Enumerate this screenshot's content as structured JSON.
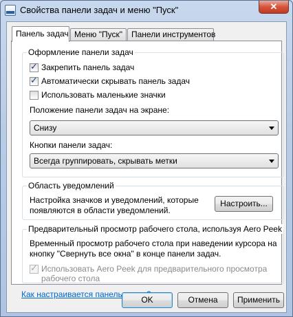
{
  "window": {
    "title": "Свойства панели задач и меню \"Пуск\"",
    "close_label": "✕"
  },
  "tabs": [
    {
      "label": "Панель задач",
      "active": true
    },
    {
      "label": "Меню \"Пуск\"",
      "active": false
    },
    {
      "label": "Панели инструментов",
      "active": false
    }
  ],
  "appearance": {
    "group_label": "Оформление панели задач",
    "lock_taskbar": {
      "label": "Закрепить панель задач",
      "checked": true
    },
    "autohide": {
      "label": "Автоматически скрывать панель задач",
      "checked": true
    },
    "small_icons": {
      "label": "Использовать маленькие значки",
      "checked": false
    },
    "location_label": "Положение панели задач на экране:",
    "location_value": "Снизу",
    "buttons_label": "Кнопки панели задач:",
    "buttons_value": "Всегда группировать, скрывать метки"
  },
  "notification": {
    "group_label": "Область уведомлений",
    "description_line1": "Настройка значков и уведомлений, которые",
    "description_line2": "появляются в области уведомлений.",
    "customize_label": "Настроить..."
  },
  "aero_peek": {
    "group_label": "Предварительный просмотр рабочего стола, используя Aero Peek",
    "description_line1": "Временный просмотр рабочего стола при наведении курсора на",
    "description_line2": "кнопку \"Свернуть все окна\" в конце панели задач.",
    "checkbox_line1": "Использовать Aero Peek для предварительного просмотра",
    "checkbox_line2": "рабочего стола",
    "checkbox_checked": true,
    "checkbox_enabled": false
  },
  "help_link": "Как настраивается панель задач?",
  "buttons": {
    "ok": "OK",
    "cancel": "Отмена",
    "apply": "Применить"
  }
}
